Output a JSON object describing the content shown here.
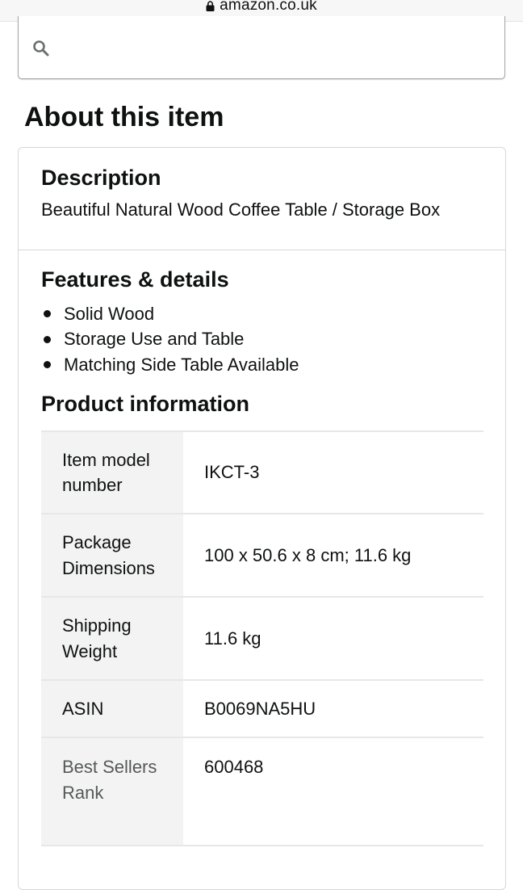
{
  "browser": {
    "url": "amazon.co.uk"
  },
  "search": {
    "placeholder": "",
    "value": ""
  },
  "about": {
    "heading": "About this item"
  },
  "description": {
    "heading": "Description",
    "text": "Beautiful Natural Wood Coffee Table / Storage Box"
  },
  "features": {
    "heading": "Features & details",
    "items": [
      "Solid Wood",
      "Storage Use and Table",
      "Matching Side Table Available"
    ]
  },
  "product_info": {
    "heading": "Product information",
    "rows": [
      {
        "label": "Item model number",
        "value": "IKCT-3"
      },
      {
        "label": "Package Dimensions",
        "value": "100 x 50.6 x 8 cm; 11.6 kg"
      },
      {
        "label": "Shipping Weight",
        "value": "11.6 kg"
      },
      {
        "label": "ASIN",
        "value": "B0069NA5HU"
      },
      {
        "label": "Best Sellers Rank",
        "value": "600468"
      }
    ]
  }
}
